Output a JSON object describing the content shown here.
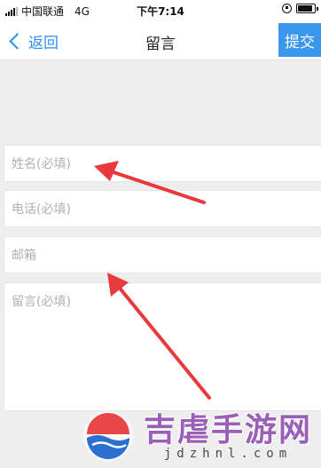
{
  "status_bar": {
    "carrier": "中国联通",
    "network": "4G",
    "time": "下午7:14",
    "battery_level": 0.9
  },
  "nav": {
    "back_label": "返回",
    "title": "留言",
    "submit_label": "提交"
  },
  "form": {
    "name_placeholder": "姓名(必填)",
    "phone_placeholder": "电话(必填)",
    "email_placeholder": "邮箱",
    "message_placeholder": "留言(必填)"
  },
  "colors": {
    "accent": "#3b97ec",
    "annotation_arrow": "#e8393e",
    "background": "#eeeeee"
  },
  "watermark": {
    "title": "吉虐手游网",
    "url": "jdzhnl.com"
  }
}
